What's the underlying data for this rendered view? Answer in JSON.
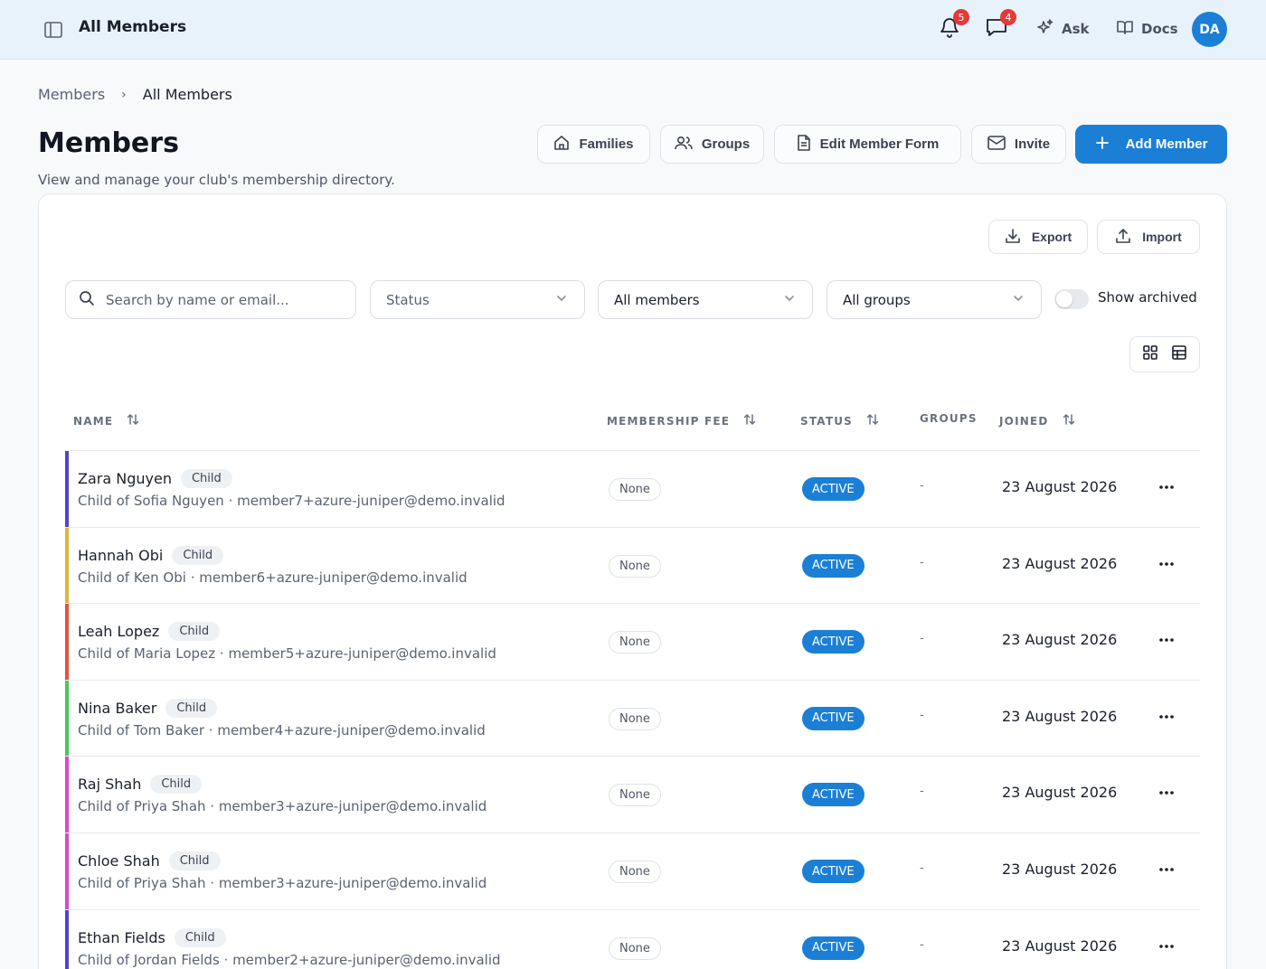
{
  "topbar": {
    "title": "All Members",
    "notifications_count": "5",
    "messages_count": "4",
    "ask_label": "Ask",
    "docs_label": "Docs",
    "avatar_initials": "DA"
  },
  "breadcrumb": {
    "parent": "Members",
    "current": "All Members"
  },
  "header": {
    "title": "Members",
    "subtitle": "View and manage your club's membership directory.",
    "families_label": "Families",
    "groups_label": "Groups",
    "edit_form_label": "Edit Member Form",
    "invite_label": "Invite",
    "add_member_label": "Add Member"
  },
  "toolbar": {
    "export_label": "Export",
    "import_label": "Import"
  },
  "filters": {
    "search_placeholder": "Search by name or email...",
    "status_placeholder": "Status",
    "members_value": "All members",
    "groups_value": "All groups",
    "show_archived_label": "Show archived",
    "show_archived_on": false
  },
  "table": {
    "columns": {
      "name": "NAME",
      "fee": "MEMBERSHIP FEE",
      "status": "STATUS",
      "groups": "GROUPS",
      "joined": "JOINED"
    },
    "rows": [
      {
        "name": "Zara Nguyen",
        "tag": "Child",
        "subtitle": "Child of Sofia Nguyen · member7+azure-juniper@demo.invalid",
        "fee": "None",
        "status": "ACTIVE",
        "groups": "-",
        "joined": "23 August 2026",
        "accent": "#4f46c8"
      },
      {
        "name": "Hannah Obi",
        "tag": "Child",
        "subtitle": "Child of Ken Obi · member6+azure-juniper@demo.invalid",
        "fee": "None",
        "status": "ACTIVE",
        "groups": "-",
        "joined": "23 August 2026",
        "accent": "#e0b43a"
      },
      {
        "name": "Leah Lopez",
        "tag": "Child",
        "subtitle": "Child of Maria Lopez · member5+azure-juniper@demo.invalid",
        "fee": "None",
        "status": "ACTIVE",
        "groups": "-",
        "joined": "23 August 2026",
        "accent": "#e0543f"
      },
      {
        "name": "Nina Baker",
        "tag": "Child",
        "subtitle": "Child of Tom Baker · member4+azure-juniper@demo.invalid",
        "fee": "None",
        "status": "ACTIVE",
        "groups": "-",
        "joined": "23 August 2026",
        "accent": "#4cc65a"
      },
      {
        "name": "Raj Shah",
        "tag": "Child",
        "subtitle": "Child of Priya Shah · member3+azure-juniper@demo.invalid",
        "fee": "None",
        "status": "ACTIVE",
        "groups": "-",
        "joined": "23 August 2026",
        "accent": "#d94ac9"
      },
      {
        "name": "Chloe Shah",
        "tag": "Child",
        "subtitle": "Child of Priya Shah · member3+azure-juniper@demo.invalid",
        "fee": "None",
        "status": "ACTIVE",
        "groups": "-",
        "joined": "23 August 2026",
        "accent": "#d94ac9"
      },
      {
        "name": "Ethan Fields",
        "tag": "Child",
        "subtitle": "Child of Jordan Fields · member2+azure-juniper@demo.invalid",
        "fee": "None",
        "status": "ACTIVE",
        "groups": "-",
        "joined": "23 August 2026",
        "accent": "#4f46c8"
      }
    ]
  },
  "colors": {
    "primary": "#1b7fd6",
    "badge": "#e53935",
    "topbar_bg": "#e8f2fb"
  },
  "icons": [
    "sidebar-toggle-icon",
    "bell-icon",
    "chat-icon",
    "sparkle-icon",
    "book-icon",
    "home-icon",
    "users-icon",
    "file-icon",
    "mail-icon",
    "plus-icon",
    "download-icon",
    "upload-icon",
    "search-icon",
    "chevron-down-icon",
    "grid-icon",
    "table-icon",
    "sort-icon",
    "more-icon"
  ]
}
